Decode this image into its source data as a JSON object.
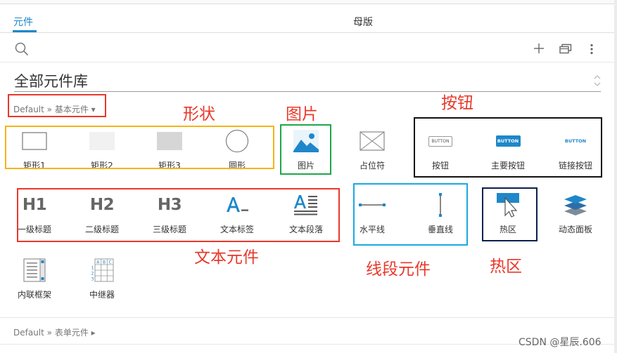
{
  "tabs": [
    {
      "label": "元件"
    },
    {
      "label": "母版"
    }
  ],
  "library": {
    "title": "全部元件库"
  },
  "breadcrumbs": {
    "basic": "Default » 基本元件 ▾",
    "form": "Default » 表单元件 ▸"
  },
  "widgets": {
    "rect1": "矩形1",
    "rect2": "矩形2",
    "rect3": "矩形3",
    "circle": "圆形",
    "image": "图片",
    "placeholder": "占位符",
    "button": "按钮",
    "primary_button": "主要按钮",
    "link_button": "链接按钮",
    "h1": "一级标题",
    "h2": "二级标题",
    "h3": "三级标题",
    "text_label": "文本标签",
    "text_paragraph": "文本段落",
    "hline": "水平线",
    "vline": "垂直线",
    "hotspot": "热区",
    "dynamic_panel": "动态面板",
    "inline_frame": "内联框架",
    "repeater": "中继器"
  },
  "icon_text": {
    "h1": "H1",
    "h2": "H2",
    "h3": "H3",
    "button_icon": "BUTTON",
    "primary_button_icon": "BUTTON",
    "link_button_icon": "BUTTON",
    "repeater_cols": [
      "A",
      "B",
      "C"
    ],
    "repeater_rows": [
      "1",
      "2",
      "3"
    ]
  },
  "annotations": {
    "shapes": "形状",
    "image": "图片",
    "button": "按钮",
    "text": "文本元件",
    "lines": "线段元件",
    "hotspot": "热区"
  },
  "colors": {
    "accent": "#1e87c9",
    "annotation_red": "#e8382b",
    "box_red": "#e8382b",
    "box_yellow": "#f5b417",
    "box_green": "#1fa64a",
    "box_black": "#111111",
    "box_cyan": "#1aa9e1",
    "box_navy": "#0b1f4d"
  },
  "watermark": "CSDN @星辰.606"
}
